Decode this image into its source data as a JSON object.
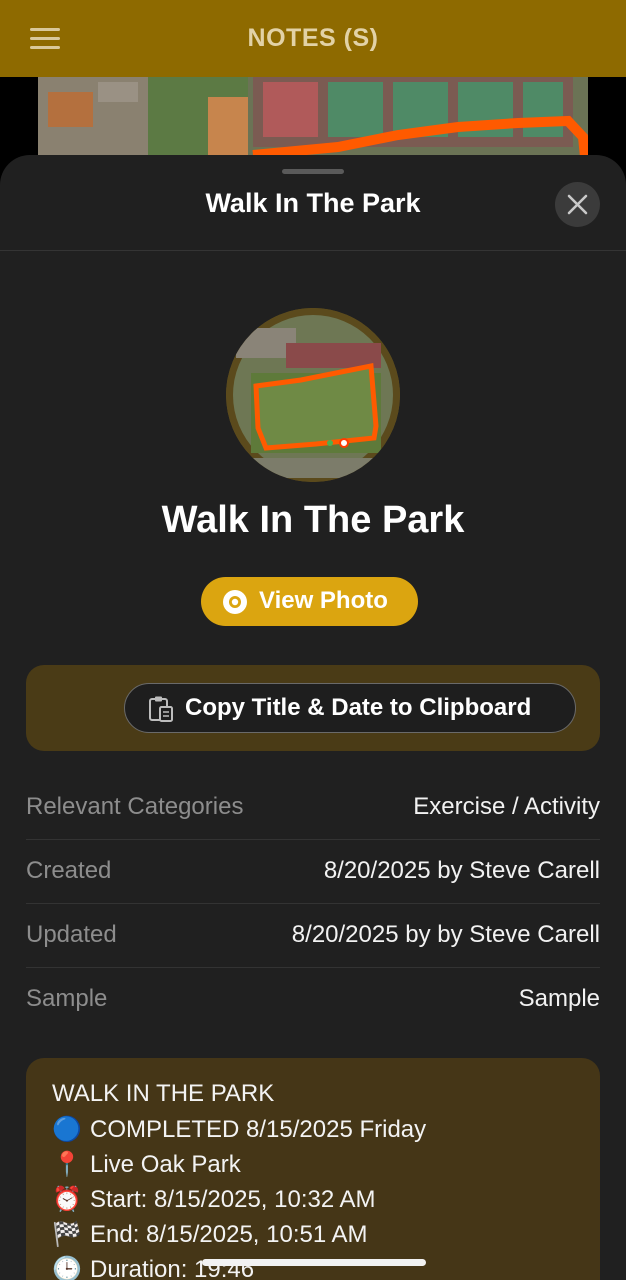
{
  "app_bar": {
    "title": "NOTES (S)"
  },
  "sheet": {
    "header_title": "Walk In The Park",
    "note_title": "Walk In The Park",
    "view_photo_label": "View Photo",
    "copy_button_label": "Copy Title & Date to Clipboard"
  },
  "details": [
    {
      "label": "Relevant Categories",
      "value": "Exercise / Activity"
    },
    {
      "label": "Created",
      "value": "8/20/2025 by Steve Carell"
    },
    {
      "label": "Updated",
      "value": "8/20/2025 by by Steve Carell"
    },
    {
      "label": "Sample",
      "value": "Sample"
    }
  ],
  "notes": {
    "heading": "WALK IN THE PARK",
    "lines": [
      {
        "icon": "🔵",
        "icon_name": "blue-circle-icon",
        "text": "COMPLETED 8/15/2025 Friday"
      },
      {
        "icon": "📍",
        "icon_name": "pin-icon",
        "text": "Live Oak Park"
      },
      {
        "icon": "⏰",
        "icon_name": "alarm-clock-icon",
        "text": "Start: 8/15/2025, 10:32 AM"
      },
      {
        "icon": "🏁",
        "icon_name": "checkered-flag-icon",
        "text": "End: 8/15/2025, 10:51 AM"
      },
      {
        "icon": "🕒",
        "icon_name": "clock-icon",
        "text": "Duration: 19:46"
      }
    ]
  },
  "colors": {
    "app_bar": "#8e6a00",
    "accent": "#dba510",
    "sheet_bg": "#202020",
    "card_bg": "#4a3b16",
    "route": "#ff5a00"
  }
}
